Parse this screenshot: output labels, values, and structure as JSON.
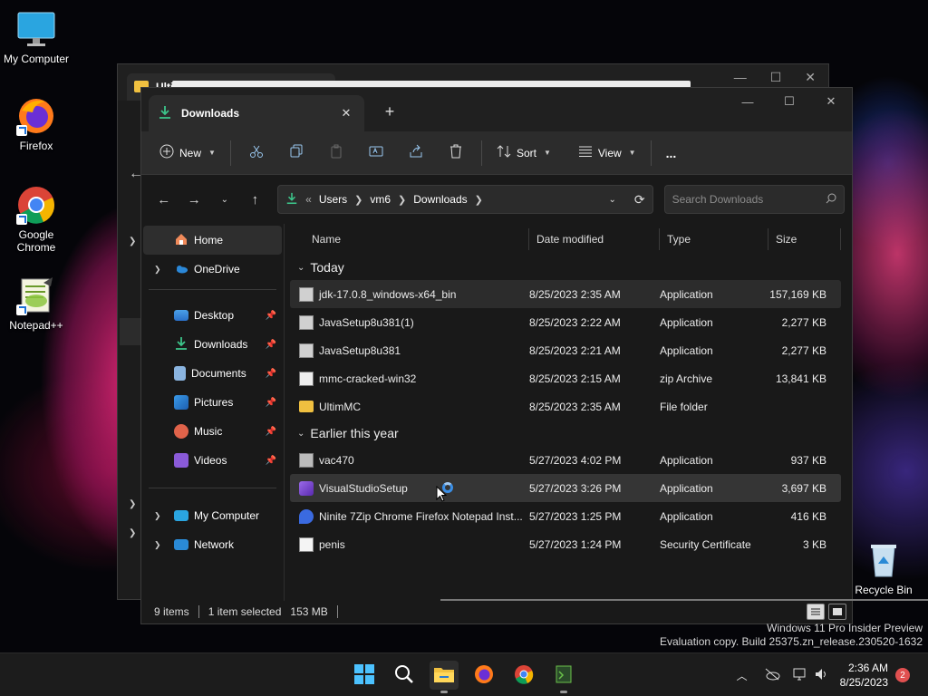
{
  "desktop": {
    "icons": [
      {
        "label": "My Computer"
      },
      {
        "label": "Firefox"
      },
      {
        "label": "Google Chrome"
      },
      {
        "label": "Notepad++"
      },
      {
        "label": "Recycle Bin"
      }
    ]
  },
  "background_window": {
    "tab_label": "Ulti"
  },
  "explorer": {
    "tab_label": "Downloads",
    "toolbar": {
      "new_label": "New",
      "sort_label": "Sort",
      "view_label": "View",
      "more_label": "..."
    },
    "address": {
      "crumbs": [
        "Users",
        "vm6",
        "Downloads"
      ],
      "overflow": "«"
    },
    "search": {
      "placeholder": "Search Downloads"
    },
    "nav": {
      "home": "Home",
      "onedrive": "OneDrive",
      "desktop": "Desktop",
      "downloads": "Downloads",
      "documents": "Documents",
      "pictures": "Pictures",
      "music": "Music",
      "videos": "Videos",
      "mycomputer": "My Computer",
      "network": "Network"
    },
    "columns": {
      "name": "Name",
      "date": "Date modified",
      "type": "Type",
      "size": "Size"
    },
    "groups": {
      "today": "Today",
      "earlier": "Earlier this year"
    },
    "files": [
      {
        "name": "jdk-17.0.8_windows-x64_bin",
        "date": "8/25/2023 2:35 AM",
        "type": "Application",
        "size": "157,169 KB"
      },
      {
        "name": "JavaSetup8u381(1)",
        "date": "8/25/2023 2:22 AM",
        "type": "Application",
        "size": "2,277 KB"
      },
      {
        "name": "JavaSetup8u381",
        "date": "8/25/2023 2:21 AM",
        "type": "Application",
        "size": "2,277 KB"
      },
      {
        "name": "mmc-cracked-win32",
        "date": "8/25/2023 2:15 AM",
        "type": "zip Archive",
        "size": "13,841 KB"
      },
      {
        "name": "UltimMC",
        "date": "8/25/2023 2:35 AM",
        "type": "File folder",
        "size": ""
      },
      {
        "name": "vac470",
        "date": "5/27/2023 4:02 PM",
        "type": "Application",
        "size": "937 KB"
      },
      {
        "name": "VisualStudioSetup",
        "date": "5/27/2023 3:26 PM",
        "type": "Application",
        "size": "3,697 KB"
      },
      {
        "name": "Ninite 7Zip Chrome Firefox Notepad Inst...",
        "date": "5/27/2023 1:25 PM",
        "type": "Application",
        "size": "416 KB"
      },
      {
        "name": "penis",
        "date": "5/27/2023 1:24 PM",
        "type": "Security Certificate",
        "size": "3 KB"
      }
    ],
    "status": {
      "items": "9 items",
      "selected": "1 item selected",
      "size": "153 MB"
    }
  },
  "watermark": {
    "line1": "Windows 11 Pro Insider Preview",
    "line2": "Evaluation copy. Build 25375.zn_release.230520-1632"
  },
  "taskbar": {
    "time": "2:36 AM",
    "date": "8/25/2023",
    "notification_count": "2"
  }
}
